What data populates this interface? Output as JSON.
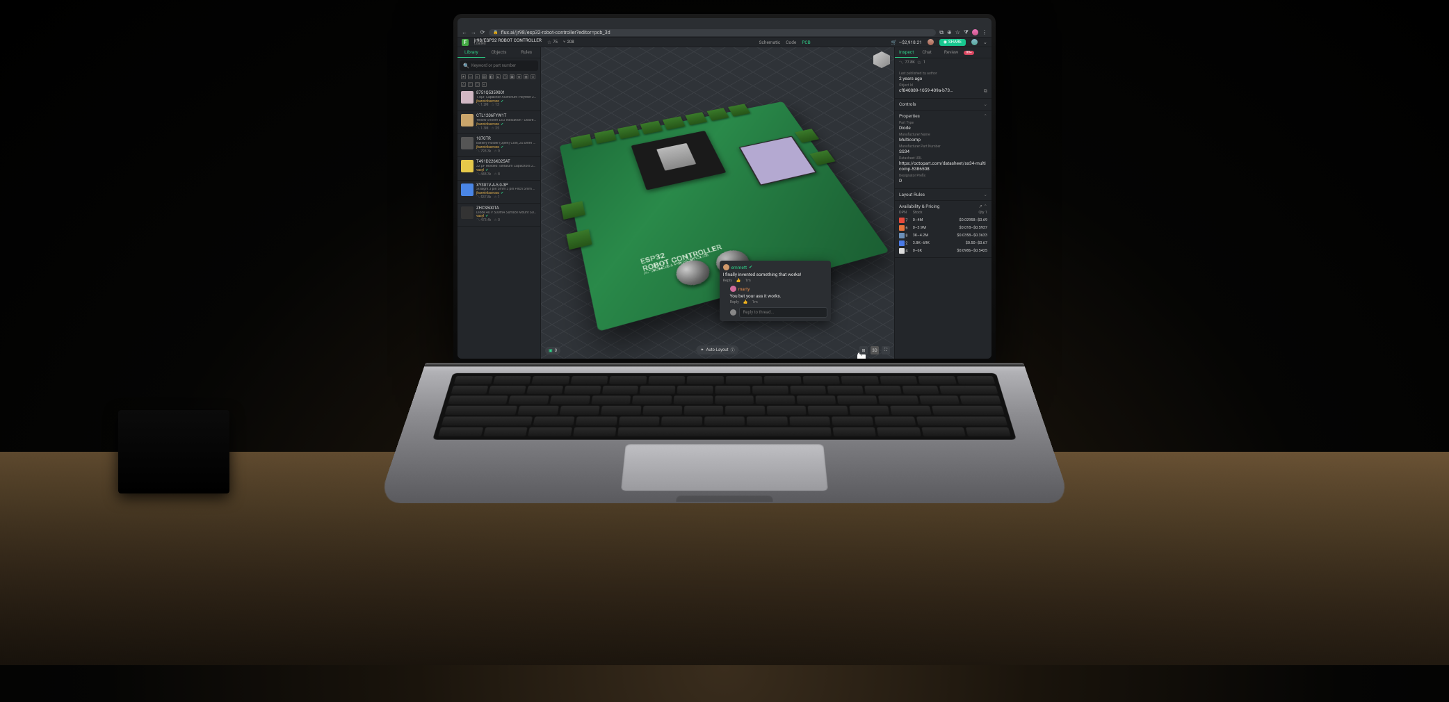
{
  "browser": {
    "url": "flux.ai/jr98/esp32-robot-controller?editor=pcb_3d"
  },
  "app": {
    "breadcrumb": "jr98/ESP32 ROBOT CONTROLLER",
    "status": "Loaded",
    "stars": "75",
    "forks": "208",
    "modes": {
      "schematic": "Schematic",
      "code": "Code",
      "pcb": "PCB"
    },
    "cart_total": "~$2,918.21",
    "share": "SHARE"
  },
  "leftTabs": {
    "library": "Library",
    "objects": "Objects",
    "rules": "Rules"
  },
  "search": {
    "placeholder": "Keyword or part number"
  },
  "parts": [
    {
      "pn": "8751Q5359001",
      "desc": "1.8µF Capacitor Aluminum Polymer 20% 16V SMD 5x5.3m…",
      "mfr": "jharwinbarrozo",
      "views": "1.2M",
      "stars": "13",
      "thumb": "#d1b8c4"
    },
    {
      "pn": "CTL1206FYW1T",
      "desc": "Yellow 590nm LED Indication - Discrete 1.7V 1206 (3216 Metr…",
      "mfr": "jharwinbarrozo",
      "views": "1.3M",
      "stars": "25",
      "thumb": "#caa56b"
    },
    {
      "pn": "1070TR",
      "desc": "Battery Holder (Open) Coin, 20.0mm 1 Cell SMD (SMT) Tab…",
      "mfr": "jharwinbarrozo",
      "views": "793.3k",
      "stars": "9",
      "thumb": "#555"
    },
    {
      "pn": "T491D226K025AT",
      "desc": "22 µF Molded Tantalum Capacitors 25 V 2917 (7343 M…",
      "mfr": "vasyl",
      "views": "448.3k",
      "stars": "8",
      "thumb": "#e6c94a"
    },
    {
      "pn": "XY301V-A-5.0-3P",
      "desc": "Straight 3 pin 5mm 3 pin Pitch 5mm 15A 1.5 300V Screw t…",
      "mfr": "jharwinbarrozo",
      "views": "537.8k",
      "stars": "1",
      "thumb": "#4a86e6"
    },
    {
      "pn": "ZHCS500TA",
      "desc": "Diode 40 V 500mA Surface Mount SOT-23-3 ADiode Spec…",
      "mfr": "vasyl",
      "views": "473.4k",
      "stars": "0",
      "thumb": "#333"
    }
  ],
  "silkscreen": {
    "title": "ESP32\nROBOT CONTROLLER",
    "sub": "AUTONOMOUS & RADIO CONTROLLED"
  },
  "autolayout": "Auto-Layout",
  "errors": "0",
  "view3d": "3D",
  "mapPin": "1",
  "comments": [
    {
      "name": "emmett",
      "body": "I finally invented something that works!",
      "reply": "Reply",
      "time": "1m",
      "avatar": "#d19a6b",
      "nameColor": "#2fd28a"
    },
    {
      "name": "marty",
      "body": "You bet your ass it works.",
      "reply": "Reply",
      "time": "1m",
      "avatar": "#d16b9a",
      "nameColor": "#e78b4a"
    }
  ],
  "replyPlaceholder": "Reply to thread...",
  "rightTabs": {
    "inspect": "Inspect",
    "chat": "Chat",
    "review": "Review",
    "reviewBadge": "99+"
  },
  "headerStats": {
    "views": "77.8K",
    "star": "1"
  },
  "meta": {
    "published_label": "Last published by author",
    "published_value": "2 years ago",
    "objectid_label": "Object Id",
    "objectid_value": "cf840089-1059-409a-b73…"
  },
  "controls_label": "Controls",
  "properties_label": "Properties",
  "props": {
    "part_type_label": "Part Type",
    "part_type": "Diode",
    "mfr_name_label": "Manufacturer Name",
    "mfr_name": "Multicomp",
    "mfr_pn_label": "Manufacturer Part Number",
    "mfr_pn": "SS34",
    "datasheet_label": "Datasheet URL",
    "datasheet": "https://octopart.com/datasheet/ss34-multicomp-5386508",
    "prefix_label": "Designator Prefix",
    "prefix": "D"
  },
  "layout_rules_label": "Layout Rules",
  "pricing_label": "Availability & Pricing",
  "pricing_cols": {
    "dpn": "DPN",
    "stock": "Stock",
    "qty": "Qty 1"
  },
  "pricing_rows": [
    {
      "dist": "#e64a3c",
      "n": "7",
      "stock": "0–4M",
      "price": "$0.02958–$0.69"
    },
    {
      "dist": "#e6733c",
      "n": "6",
      "stock": "0–3.9M",
      "price": "$0.018–$0.5937"
    },
    {
      "dist": "#6b8fb8",
      "n": "8",
      "stock": "3K–4.2M",
      "price": "$0.0358–$0.3633"
    },
    {
      "dist": "#4a7ae6",
      "n": "2",
      "stock": "3.8K–69K",
      "price": "$0.50–$0.67"
    },
    {
      "dist": "#ddd",
      "n": "4",
      "stock": "0–6K",
      "price": "$0.0986–$0.5425"
    }
  ]
}
